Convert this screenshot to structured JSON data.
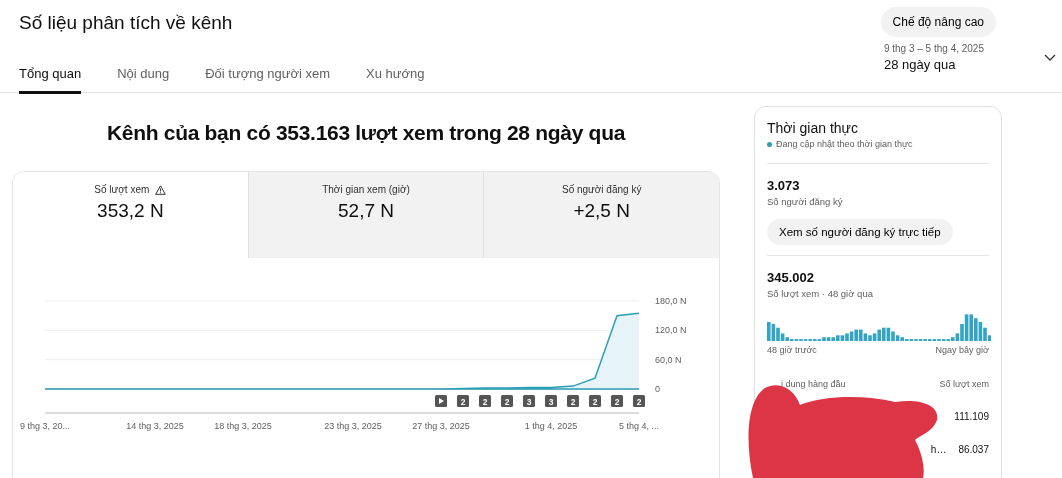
{
  "title": "Số liệu phân tích về kênh",
  "advanced_button": "Chế độ nâng cao",
  "tabs": [
    {
      "label": "Tổng quan",
      "selected": true
    },
    {
      "label": "Nội dung",
      "selected": false
    },
    {
      "label": "Đối tượng người xem",
      "selected": false
    },
    {
      "label": "Xu hướng",
      "selected": false
    }
  ],
  "date_range": {
    "dates": "9 thg 3 – 5 thg 4, 2025",
    "label": "28 ngày qua"
  },
  "headline": "Kênh của bạn có 353.163 lượt xem trong 28 ngày qua",
  "metrics": [
    {
      "label": "Số lượt xem",
      "value": "353,2 N",
      "warning": true,
      "selected": true
    },
    {
      "label": "Thời gian xem (giờ)",
      "value": "52,7 N",
      "warning": false,
      "selected": false
    },
    {
      "label": "Số người đăng ký",
      "value": "+2,5 N",
      "warning": false,
      "selected": false
    }
  ],
  "chart": {
    "chart_data": {
      "type": "area",
      "categories": [
        "9 thg 3, 20...",
        null,
        null,
        null,
        null,
        "14 thg 3, 2025",
        null,
        null,
        null,
        "18 thg 3, 2025",
        null,
        null,
        null,
        null,
        "23 thg 3, 2025",
        null,
        null,
        null,
        "27 thg 3, 2025",
        null,
        null,
        null,
        null,
        "1 thg 4, 2025",
        null,
        null,
        null,
        "5 thg 4, ..."
      ],
      "series": [
        {
          "color": "#2c9fb5",
          "values": [
            0,
            0,
            0,
            0,
            0,
            0,
            0,
            0,
            0,
            0,
            0,
            0,
            0,
            0,
            0,
            0,
            0,
            0,
            0,
            1,
            2,
            2,
            3,
            3,
            6,
            22,
            150,
            155
          ]
        }
      ],
      "ylim": [
        0,
        180
      ],
      "yticks": [
        {
          "value": 0,
          "label": "0"
        },
        {
          "value": 60,
          "label": "60,0 N"
        },
        {
          "value": 120,
          "label": "120,0 N"
        },
        {
          "value": 180,
          "label": "180,0 N"
        }
      ]
    },
    "markers": [
      {
        "kind": "play"
      },
      {
        "kind": "count",
        "label": "2"
      },
      {
        "kind": "count",
        "label": "2"
      },
      {
        "kind": "count",
        "label": "2"
      },
      {
        "kind": "count",
        "label": "3"
      },
      {
        "kind": "count",
        "label": "3"
      },
      {
        "kind": "count",
        "label": "2"
      },
      {
        "kind": "count",
        "label": "2"
      },
      {
        "kind": "count",
        "label": "2"
      },
      {
        "kind": "count",
        "label": "2"
      }
    ]
  },
  "realtime": {
    "title": "Thời gian thực",
    "status": "Đang cập nhật theo thời gian thực",
    "live": true,
    "subscribers": {
      "value": "3.073",
      "label": "Số người đăng ký"
    },
    "live_button": "Xem số người đăng ký trực tiếp",
    "views": {
      "value": "345.002",
      "label": "Số lượt xem · 48 giờ qua"
    },
    "spark_start": "48 giờ trước",
    "spark_end": "Ngay bây giờ",
    "top_header": {
      "column_1": "i dung hàng đầu",
      "column_2": "Số lượt xem"
    },
    "top_rows": [
      {
        "views": "111.109"
      },
      {
        "title": "h…",
        "views": "86.037"
      }
    ]
  }
}
